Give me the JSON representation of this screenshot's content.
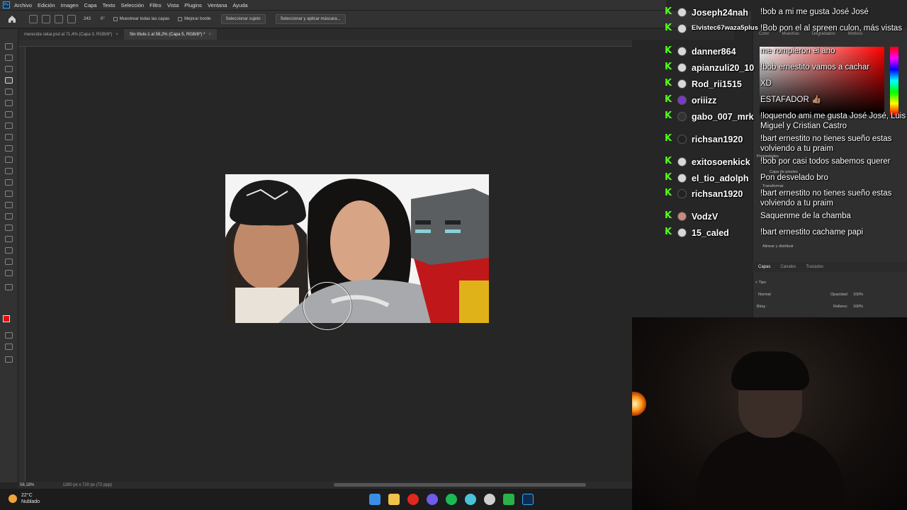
{
  "menubar": {
    "logo": "Ps",
    "items": [
      "Archivo",
      "Edición",
      "Imagen",
      "Capa",
      "Texto",
      "Selección",
      "Filtro",
      "Vista",
      "Plugins",
      "Ventana",
      "Ayuda"
    ]
  },
  "options": {
    "brush_size": "243",
    "angle": "0°",
    "sample_all_layers": "Muestrear todas las capas",
    "enhance_edge": "Mejorar borde",
    "select_subject": "Seleccionar sujeto",
    "select_and_mask": "Seleccionar y aplicar máscara..."
  },
  "tabs": [
    {
      "label": "merecida rakai.psd al 71,4% (Capa 3, RGB/8*)",
      "close": "×"
    },
    {
      "label": "Sin título-1 al 58,2% (Capa 5, RGB/8*) *",
      "close": "×"
    }
  ],
  "status": {
    "zoom": "58,18%",
    "doc_size": "1280 px x 720 px (72 ppp)"
  },
  "taskbar": {
    "temperature": "22°C",
    "condition": "Nublado",
    "app_colors": [
      "#3a8ee6",
      "#f0c24a",
      "#e0281e",
      "#6f5ce8",
      "#1db954",
      "#4cc2d8",
      "#cfcfcf",
      "#28b34a",
      "#31a8ff"
    ]
  },
  "right_panel": {
    "color_tabs": [
      "Color",
      "Muestras",
      "Degradados",
      "Motivos"
    ],
    "properties_label": "Propiedades",
    "layer_label": "Capa de píxeles",
    "transform_label": "Transformar",
    "align_label": "Alinear y distribuir",
    "layers_tabs": [
      "Capas",
      "Canales",
      "Trazados"
    ],
    "kind_filter": "Tipo",
    "blend_mode": "Normal",
    "opacity_label": "Opacidad:",
    "opacity_value": "100%",
    "lock_label": "Bloq.:",
    "fill_label": "Relleno:",
    "fill_value": "100%"
  },
  "chat": [
    {
      "user": "Joseph24nah",
      "message": "!bob a mi me gusta José José"
    },
    {
      "user": "Elvistec67waza5plus",
      "message": "!Bob pon el al spreen culon, más vistas"
    },
    {
      "user": "danner864",
      "message": "me rompieron el ano"
    },
    {
      "user": "apianzuli20_10",
      "message": "!bob ernestito vamos a cachar"
    },
    {
      "user": "Rod_rii1515",
      "message": "XD"
    },
    {
      "user": "oriiizz",
      "message": "ESTAFADOR 👍🏽"
    },
    {
      "user": "gabo_007_mrk",
      "message": "!loquendo ami me gusta José José, Luis Miguel y Cristian Castro"
    },
    {
      "user": "richsan1920",
      "message": "!bart ernestito no tienes sueño estas volviendo a tu praim"
    },
    {
      "user": "exitosoenkick",
      "message": "!bob por casi todos sabemos querer"
    },
    {
      "user": "el_tio_adolph",
      "message": "Pon desvelado bro"
    },
    {
      "user": "richsan1920",
      "message": "!bart ernestito no tienes sueño estas volviendo a tu praim"
    },
    {
      "user": "VodzV",
      "message": "Saquenme de la chamba"
    },
    {
      "user": "15_caled",
      "message": "!bart ernestito cachame papi"
    }
  ],
  "colors": {
    "kick_green": "#53fc18",
    "foreground": "#e01010",
    "background": "#ffffff"
  }
}
